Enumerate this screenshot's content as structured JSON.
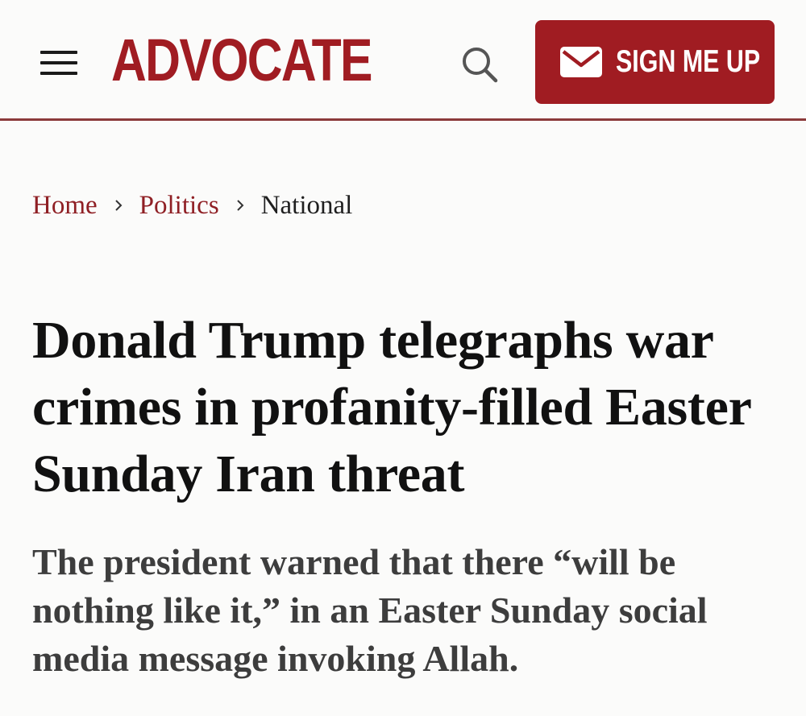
{
  "header": {
    "logo": "ADVOCATE",
    "signup_label": "SIGN ME UP",
    "menu_icon": "hamburger-menu-icon",
    "search_icon": "search-icon",
    "mail_icon": "envelope-icon"
  },
  "breadcrumb": {
    "items": [
      {
        "label": "Home"
      },
      {
        "label": "Politics"
      },
      {
        "label": "National"
      }
    ]
  },
  "article": {
    "headline": "Donald Trump telegraphs war crimes in profanity-filled Easter Sunday Iran threat",
    "dek": "The president warned that there “will be nothing like it,” in an Easter Sunday social media message invoking Allah."
  },
  "colors": {
    "brand": "#a01c22",
    "divider": "#8b3a3a",
    "link": "#8f1f24",
    "background": "#fbfbfa"
  }
}
